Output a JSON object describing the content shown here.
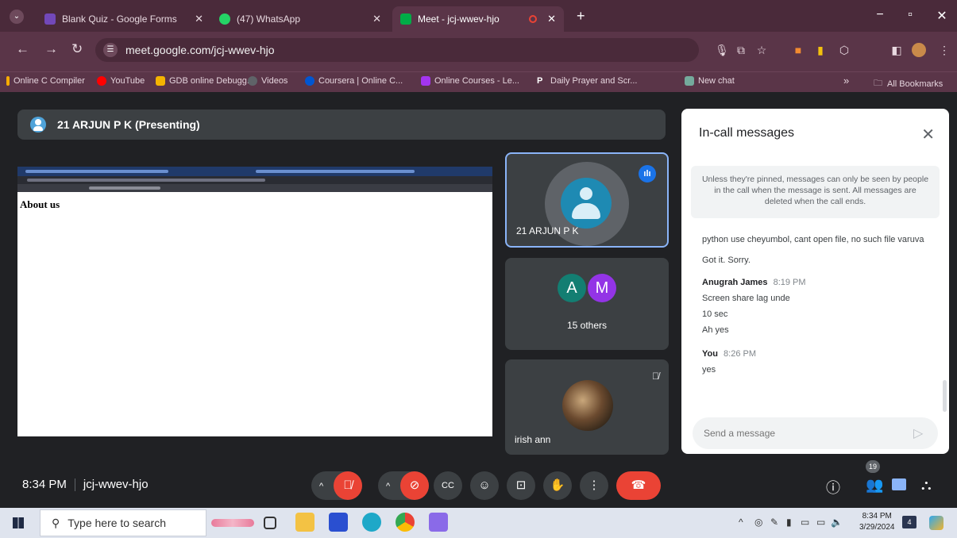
{
  "browser": {
    "tabs": [
      {
        "label": "Blank Quiz - Google Forms",
        "color": "#7248b9"
      },
      {
        "label": "(47) WhatsApp",
        "color": "#25d366"
      },
      {
        "label": "Meet - jcj-wwev-hjo",
        "color": "#00ac47"
      }
    ],
    "url": "meet.google.com/jcj-wwev-hjo",
    "bookmarks": [
      {
        "label": "Online C Compiler",
        "color": "#f9ab00"
      },
      {
        "label": "YouTube",
        "color": "#ff0000"
      },
      {
        "label": "GDB online Debugg...",
        "color": "#f4b400"
      },
      {
        "label": "Videos",
        "color": "#5f6368"
      },
      {
        "label": "Coursera | Online C...",
        "color": "#0056d2"
      },
      {
        "label": "Online Courses - Le...",
        "color": "#a435f0"
      },
      {
        "label": "Daily Prayer and Scr...",
        "color": "#ffffff"
      },
      {
        "label": "New chat",
        "color": "#74aa9c"
      }
    ],
    "bookmarks_more": "»",
    "all_bookmarks": "All Bookmarks"
  },
  "meet": {
    "presenter_bar": "21 ARJUN P K (Presenting)",
    "shared_screen_heading": "About us",
    "tiles": {
      "presenter_name": "21 ARJUN P K",
      "others_letters": [
        "A",
        "M"
      ],
      "others_label": "15 others",
      "participant_name": "irish ann"
    },
    "clock": "8:34 PM",
    "meeting_code": "jcj-wwev-hjo",
    "people_count": "19"
  },
  "panel": {
    "title": "In-call messages",
    "note": "Unless they're pinned, messages can only be seen by people in the call when the message is sent. All messages are deleted when the call ends.",
    "messages": [
      {
        "sender": "",
        "time": "",
        "lines": [
          "-",
          "python use cheyumbol, cant open file, no such file varuva",
          "Got it. Sorry."
        ]
      },
      {
        "sender": "Anugrah James",
        "time": "8:19 PM",
        "lines": [
          "Screen share lag unde",
          "10 sec",
          "Ah yes"
        ]
      },
      {
        "sender": "You",
        "time": "8:26 PM",
        "lines": [
          "yes"
        ]
      }
    ],
    "input_placeholder": "Send a message"
  },
  "taskbar": {
    "search_placeholder": "Type here to search",
    "time": "8:34 PM",
    "date": "3/29/2024",
    "notification_count": "4"
  }
}
